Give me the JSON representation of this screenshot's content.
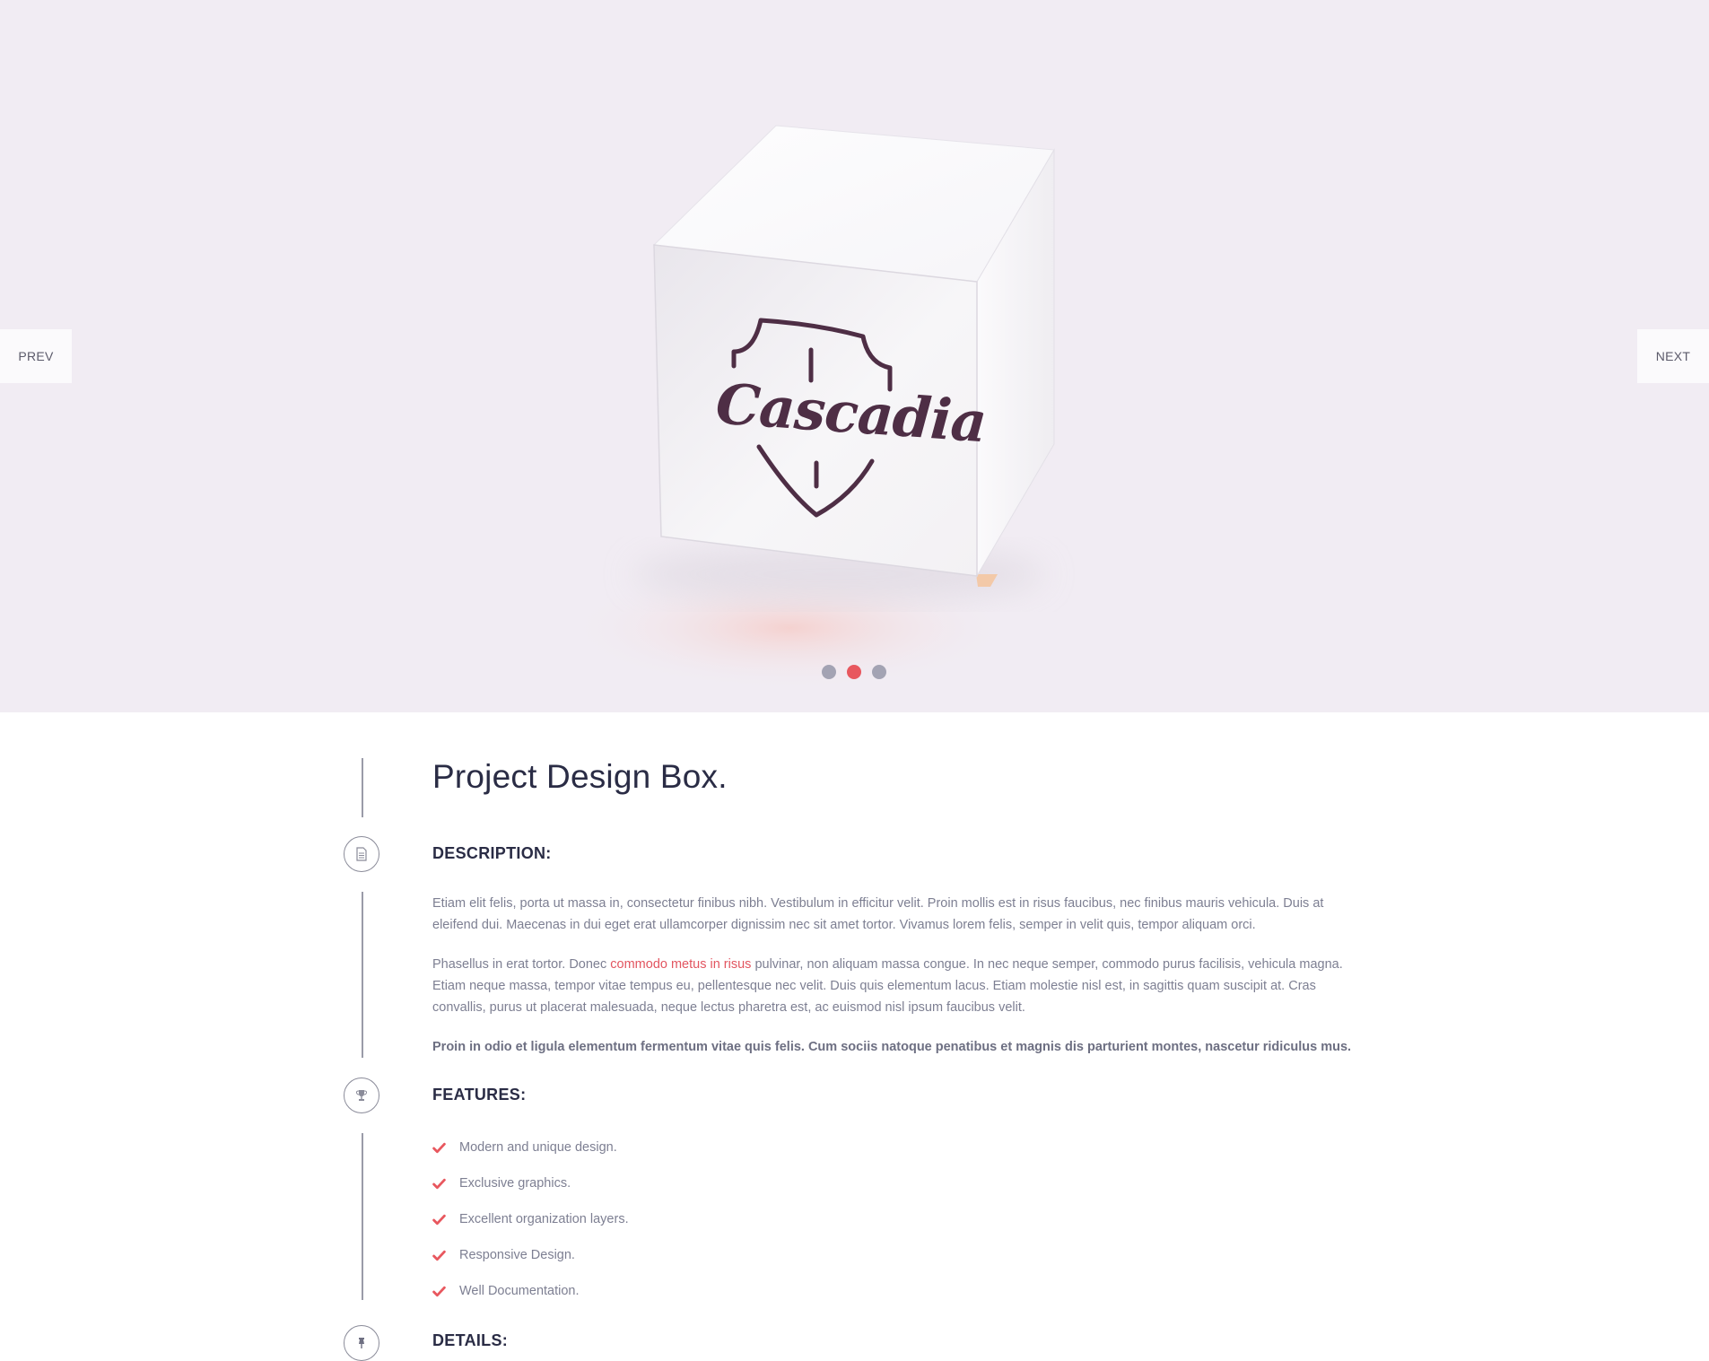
{
  "slider": {
    "prev_label": "PREV",
    "next_label": "NEXT",
    "logo_text": "Cascadia",
    "dots": [
      {
        "color": "#a3a3b3",
        "active": false
      },
      {
        "color": "#e8575e",
        "active": true
      },
      {
        "color": "#a3a3b3",
        "active": false
      }
    ]
  },
  "project": {
    "title": "Project Design Box.",
    "description": {
      "heading": "DESCRIPTION:",
      "p1": "Etiam elit felis, porta ut massa in, consectetur finibus nibh. Vestibulum in efficitur velit. Proin mollis est in risus faucibus, nec finibus mauris vehicula. Duis at eleifend dui. Maecenas in dui eget erat ullamcorper dignissim nec sit amet tortor. Vivamus lorem felis, semper in velit quis, tempor aliquam orci.",
      "p2_before": "Phasellus in erat tortor. Donec ",
      "p2_link": "commodo metus in risus",
      "p2_after": " pulvinar, non aliquam massa congue. In nec neque semper, commodo purus facilisis, vehicula magna. Etiam neque massa, tempor vitae tempus eu, pellentesque nec velit. Duis quis elementum lacus. Etiam molestie nisl est, in sagittis quam suscipit at. Cras convallis, purus ut placerat malesuada, neque lectus pharetra est, ac euismod nisl ipsum faucibus velit.",
      "p3": "Proin in odio et ligula elementum fermentum vitae quis felis. Cum sociis natoque penatibus et magnis dis parturient montes, nascetur ridiculus mus."
    },
    "features": {
      "heading": "FEATURES:",
      "items": [
        "Modern and unique design.",
        "Exclusive graphics.",
        "Excellent organization layers.",
        "Responsive Design.",
        "Well Documentation."
      ]
    },
    "details": {
      "heading": "DETAILS:"
    }
  },
  "colors": {
    "accent": "#e8575e",
    "hero_bg": "#f1ecf3",
    "heading": "#2a2c45",
    "body_text": "#7d7f92",
    "logo": "#4e2e45"
  },
  "icons": [
    "document-icon",
    "trophy-icon",
    "pin-icon",
    "check-icon"
  ]
}
